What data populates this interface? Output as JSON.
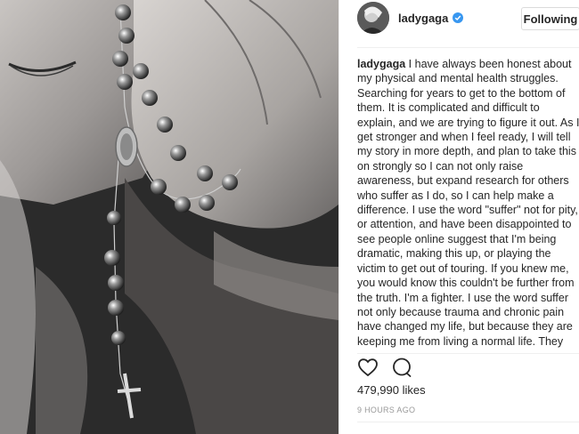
{
  "post": {
    "image_alt": "Woman holding rosary beads to her face",
    "header": {
      "username": "ladygaga",
      "verified_icon": "verified-badge-icon",
      "follow_label": "Following"
    },
    "caption": {
      "username": "ladygaga",
      "text": "I have always been honest about my physical and mental health struggles. Searching for years to get to the bottom of them. It is complicated and difficult to explain, and we are trying to figure it out. As I get stronger and when I feel ready, I will tell my story in more depth, and plan to take this on strongly so I can not only raise awareness, but expand research for others who suffer as I do, so I can help make a difference. I use the word \"suffer\" not for pity, or attention, and have been disappointed to see people online suggest that I'm being dramatic, making this up, or playing the victim to get out of touring. If you knew me, you would know this couldn't be further from the truth. I'm a fighter. I use the word suffer not only because trauma and chronic pain have changed my life, but because they are keeping me from living a normal life. They"
    },
    "actions": {
      "like_icon": "heart-icon",
      "comment_icon": "comment-icon"
    },
    "likes": "479,990 likes",
    "timestamp": "9 HOURS AGO"
  },
  "colors": {
    "verified_blue": "#3897f0",
    "text": "#262626",
    "muted": "#999999",
    "border": "#dbdbdb"
  }
}
